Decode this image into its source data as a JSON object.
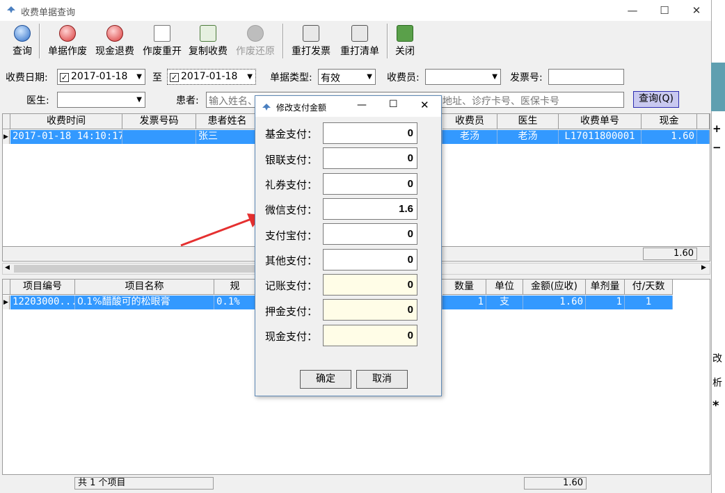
{
  "window": {
    "title": "收费单据查询"
  },
  "toolbar": {
    "query": "查询",
    "void": "单据作废",
    "cash_refund": "现金退费",
    "void_reopen": "作废重开",
    "copy_charge": "复制收费",
    "void_restore": "作废还原",
    "reprint_invoice": "重打发票",
    "reprint_list": "重打清单",
    "close": "关闭"
  },
  "filters": {
    "date_label": "收费日期:",
    "date_from": "2017-01-18",
    "to_label": "至",
    "date_to": "2017-01-18",
    "type_label": "单据类型:",
    "type_value": "有效",
    "cashier_label": "收费员:",
    "cashier_value": "",
    "invoice_label": "发票号:",
    "invoice_value": "",
    "doctor_label": "医生:",
    "doctor_value": "",
    "patient_label": "患者:",
    "patient_placeholder": "输入姓名、拼音简码、五笔简码、住院号、联系电话、地址、诊疗卡号、医保卡号",
    "query_button": "查询(Q)"
  },
  "top_grid": {
    "headers": [
      "收费时间",
      "发票号码",
      "患者姓名",
      "收费员",
      "医生",
      "收费单号",
      "现金"
    ],
    "row": {
      "time": "2017-01-18 14:10:17",
      "invoice": "",
      "patient": "张三",
      "cashier": "老汤",
      "doctor": "老汤",
      "bill_no": "L17011800001",
      "cash": "1.60"
    },
    "total": "1.60"
  },
  "bottom_grid": {
    "headers": [
      "项目编号",
      "项目名称",
      "规",
      "数量",
      "单位",
      "金额(应收)",
      "单剂量",
      "付/天数"
    ],
    "row": {
      "code": "12203000...",
      "name": "0.1%醋酸可的松眼膏",
      "spec": "0.1%",
      "qty": "1",
      "unit": "支",
      "amount": "1.60",
      "dose": "1",
      "days": "1"
    }
  },
  "status": {
    "count": "共 1 个项目",
    "total": "1.60"
  },
  "dialog": {
    "title": "修改支付金额",
    "fields": [
      {
        "label": "基金支付：",
        "value": "0"
      },
      {
        "label": "银联支付：",
        "value": "0"
      },
      {
        "label": "礼券支付：",
        "value": "0"
      },
      {
        "label": "微信支付：",
        "value": "1.6"
      },
      {
        "label": "支付宝付：",
        "value": "0"
      },
      {
        "label": "其他支付：",
        "value": "0"
      },
      {
        "label": "记账支付：",
        "value": "0"
      },
      {
        "label": "押金支付：",
        "value": "0"
      },
      {
        "label": "现金支付：",
        "value": "0"
      }
    ],
    "ok": "确定",
    "cancel": "取消"
  },
  "right_edge": {
    "glyphs": [
      "+",
      "−",
      "改",
      "析",
      "*"
    ]
  },
  "colors": {
    "selection": "#3399ff",
    "arrow": "#e53030",
    "query_btn": "#c9c9f0",
    "readonly_field": "#fffde7"
  }
}
